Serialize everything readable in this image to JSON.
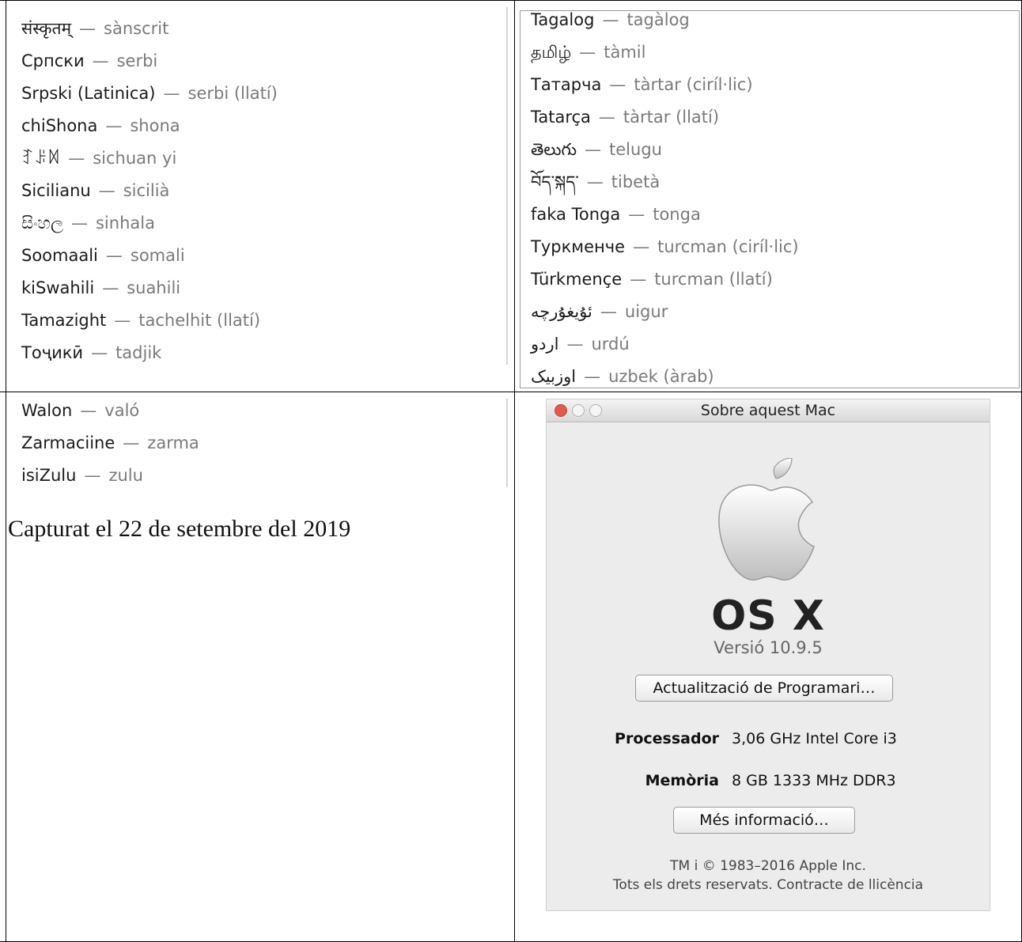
{
  "top_left_list": [
    {
      "native": "संस्कृतम्",
      "catalan": "sànscrit"
    },
    {
      "native": "Српски",
      "catalan": "serbi"
    },
    {
      "native": "Srpski (Latinica)",
      "catalan": "serbi (llatí)"
    },
    {
      "native": "chiShona",
      "catalan": "shona"
    },
    {
      "native": "ꆈꌠꉙ",
      "catalan": "sichuan yi"
    },
    {
      "native": "Sicilianu",
      "catalan": "sicilià"
    },
    {
      "native": "සිංහල",
      "catalan": "sinhala"
    },
    {
      "native": "Soomaali",
      "catalan": "somali"
    },
    {
      "native": "kiSwahili",
      "catalan": "suahili"
    },
    {
      "native": "Tamazight",
      "catalan": "tachelhit (llatí)"
    },
    {
      "native": "Тоҷикӣ",
      "catalan": "tadjik"
    }
  ],
  "top_right_list": [
    {
      "native": "Tagalog",
      "catalan": "tagàlog"
    },
    {
      "native": "தமிழ்",
      "catalan": "tàmil"
    },
    {
      "native": "Татарча",
      "catalan": "tàrtar (ciríl·lic)"
    },
    {
      "native": "Tatarça",
      "catalan": "tàrtar (llatí)"
    },
    {
      "native": "తెలుగు",
      "catalan": "telugu"
    },
    {
      "native": "བོད་སྐད་",
      "catalan": "tibetà"
    },
    {
      "native": "faka Tonga",
      "catalan": "tonga"
    },
    {
      "native": "Туркменче",
      "catalan": "turcman (ciríl·lic)"
    },
    {
      "native": "Türkmençe",
      "catalan": "turcman (llatí)"
    },
    {
      "native": "ئۇيغۇرچە",
      "catalan": "uigur"
    },
    {
      "native": "اردو",
      "catalan": "urdú"
    },
    {
      "native": "اوزبیک",
      "catalan": "uzbek (àrab)"
    }
  ],
  "bottom_left_list": [
    {
      "native": "Walon",
      "catalan": "való"
    },
    {
      "native": "Zarmaciine",
      "catalan": "zarma"
    },
    {
      "native": "isiZulu",
      "catalan": "zulu"
    }
  ],
  "separator": "—",
  "caption": "Capturat el 22 de setembre del 2019",
  "about_mac": {
    "window_title": "Sobre aquest Mac",
    "os_name": "OS X",
    "version": "Versió 10.9.5",
    "update_button": "Actualització de Programari…",
    "processor_label": "Processador",
    "processor_value": "3,06 GHz Intel Core i3",
    "memory_label": "Memòria",
    "memory_value": "8 GB 1333 MHz  DDR3",
    "more_info_button": "Més informació…",
    "footer_line1": "TM i © 1983–2016 Apple Inc.",
    "footer_line2": "Tots els drets reservats. Contracte de llicència",
    "icon": "apple-logo-icon"
  },
  "colors": {
    "close_button": "#e25a4f",
    "window_bg": "#ececec",
    "secondary_text": "#7a7a7a"
  }
}
